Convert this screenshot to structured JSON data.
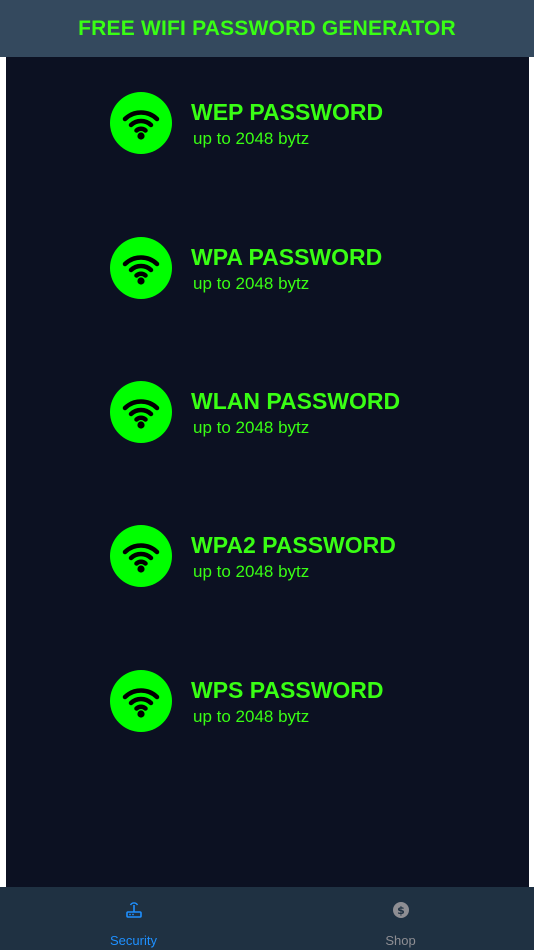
{
  "header": {
    "title": "FREE WIFI PASSWORD GENERATOR"
  },
  "items": [
    {
      "title": "WEP PASSWORD",
      "subtitle": "up to 2048 bytz",
      "icon": "wifi-icon"
    },
    {
      "title": "WPA PASSWORD",
      "subtitle": "up to 2048 bytz",
      "icon": "wifi-icon"
    },
    {
      "title": "WLAN PASSWORD",
      "subtitle": "up to 2048 bytz",
      "icon": "wifi-icon"
    },
    {
      "title": "WPA2 PASSWORD",
      "subtitle": "up to 2048 bytz",
      "icon": "wifi-icon"
    },
    {
      "title": "WPS PASSWORD",
      "subtitle": "up to 2048 bytz",
      "icon": "wifi-icon"
    }
  ],
  "tabbar": {
    "tabs": [
      {
        "label": "Security",
        "icon": "router-icon",
        "selected": true
      },
      {
        "label": "Shop",
        "icon": "dollar-coin-icon",
        "selected": false
      }
    ]
  },
  "colors": {
    "accent": "#39ff14",
    "header_bg": "#34495e",
    "content_bg": "#0c1122",
    "tabbar_bg": "#1f3142",
    "tab_active": "#1e90ff",
    "tab_inactive": "#8e8e93"
  }
}
